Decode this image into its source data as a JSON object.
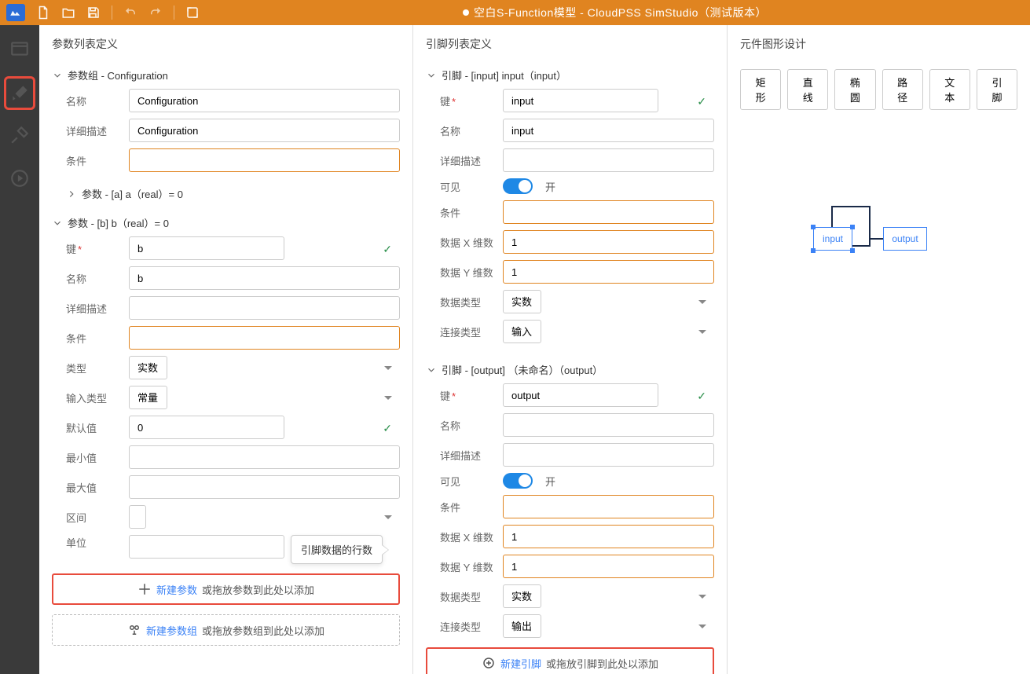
{
  "title": "空白S-Function模型 - CloudPSS SimStudio（测试版本）",
  "panels": {
    "param_list": {
      "title": "参数列表定义"
    },
    "pin_list": {
      "title": "引脚列表定义"
    },
    "graphic": {
      "title": "元件图形设计"
    }
  },
  "param_group": {
    "header": "参数组 - Configuration",
    "name_label": "名称",
    "name": "Configuration",
    "desc_label": "详细描述",
    "desc": "Configuration",
    "cond_label": "条件"
  },
  "param_a": {
    "header": "参数 - [a] a（real）= 0"
  },
  "param_b": {
    "header": "参数 - [b] b（real）= 0",
    "key_label": "键",
    "key": "b",
    "name_label": "名称",
    "name": "b",
    "desc_label": "详细描述",
    "cond_label": "条件",
    "type_label": "类型",
    "type": "实数",
    "intype_label": "输入类型",
    "intype": "常量",
    "default_label": "默认值",
    "default": "0",
    "min_label": "最小值",
    "max_label": "最大值",
    "range_label": "区间",
    "unit_label": "单位"
  },
  "tooltip": "引脚数据的行数",
  "add_param": {
    "link": "新建参数",
    "rest": "或拖放参数到此处以添加"
  },
  "add_group": {
    "link": "新建参数组",
    "rest": "或拖放参数组到此处以添加"
  },
  "pin_input": {
    "header": "引脚 - [input] input（input）",
    "key_label": "键",
    "key": "input",
    "name_label": "名称",
    "name": "input",
    "desc_label": "详细描述",
    "vis_label": "可见",
    "vis_on": "开",
    "cond_label": "条件",
    "dimx_label": "数据 X 维数",
    "dimx": "1",
    "dimy_label": "数据 Y 维数",
    "dimy": "1",
    "dtype_label": "数据类型",
    "dtype": "实数",
    "ctype_label": "连接类型",
    "ctype": "输入"
  },
  "pin_output": {
    "header": "引脚 - [output] （未命名）（output）",
    "key_label": "键",
    "key": "output",
    "name_label": "名称",
    "desc_label": "详细描述",
    "vis_label": "可见",
    "vis_on": "开",
    "cond_label": "条件",
    "dimx_label": "数据 X 维数",
    "dimx": "1",
    "dimy_label": "数据 Y 维数",
    "dimy": "1",
    "dtype_label": "数据类型",
    "dtype": "实数",
    "ctype_label": "连接类型",
    "ctype": "输出"
  },
  "add_pin": {
    "link": "新建引脚",
    "rest": "或拖放引脚到此处以添加"
  },
  "shapes": {
    "rect": "矩形",
    "line": "直线",
    "ellipse": "椭圆",
    "path": "路径",
    "text": "文本",
    "pin": "引脚"
  },
  "canvas": {
    "input": "input",
    "output": "output"
  }
}
